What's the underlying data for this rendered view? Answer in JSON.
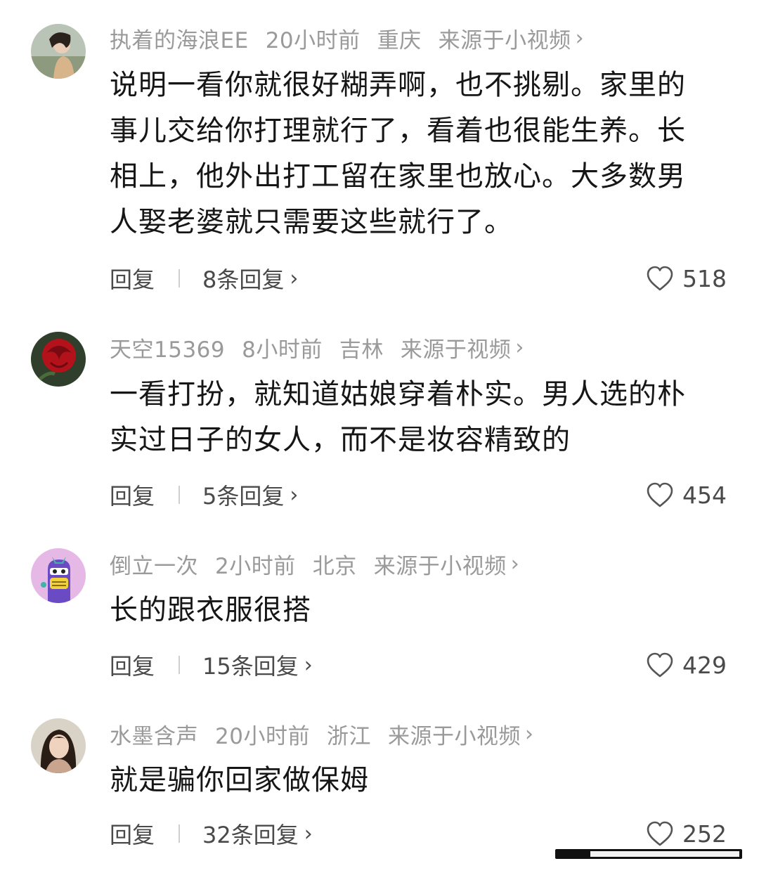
{
  "comments": [
    {
      "username": "执着的海浪EE",
      "time": "20小时前",
      "location": "重庆",
      "source": "来源于小视频",
      "lines": [
        "说明一看你就很好糊弄啊，也不挑剔。家里的",
        "事儿交给你打理就行了，看着也很能生养。长",
        "相上，他外出打工留在家里也放心。大多数男",
        "人娶老婆就只需要这些就行了。"
      ],
      "reply_label": "回复",
      "replies_label": "8条回复",
      "likes": "518"
    },
    {
      "username": "天空15369",
      "time": "8小时前",
      "location": "吉林",
      "source": "来源于视频",
      "lines": [
        "一看打扮，就知道姑娘穿着朴实。男人选的朴",
        "实过日子的女人，而不是妆容精致的"
      ],
      "reply_label": "回复",
      "replies_label": "5条回复",
      "likes": "454"
    },
    {
      "username": "倒立一次",
      "time": "2小时前",
      "location": "北京",
      "source": "来源于小视频",
      "lines": [
        "长的跟衣服很搭"
      ],
      "reply_label": "回复",
      "replies_label": "15条回复",
      "likes": "429"
    },
    {
      "username": "水墨含声",
      "time": "20小时前",
      "location": "浙江",
      "source": "来源于小视频",
      "lines": [
        "就是骗你回家做保姆"
      ],
      "reply_label": "回复",
      "replies_label": "32条回复",
      "likes": "252"
    }
  ],
  "icons": {
    "chevron": "chevron-right-icon",
    "like": "heart-outline-icon"
  },
  "colors": {
    "meta_text": "#9a9a9a",
    "body_text": "#161616",
    "action_text": "#4a4a4a"
  }
}
